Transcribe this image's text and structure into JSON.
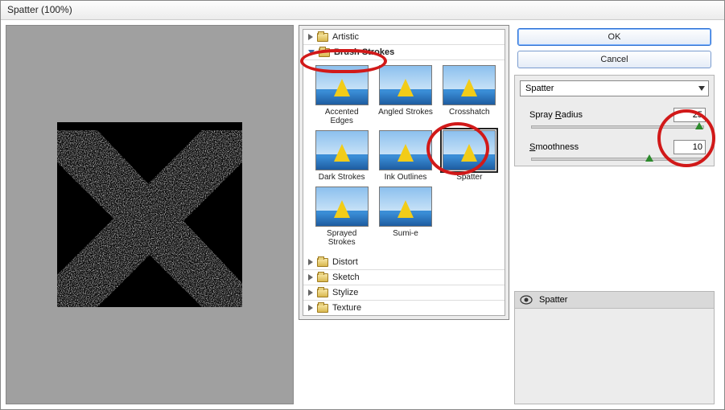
{
  "title": "Spatter (100%)",
  "buttons": {
    "ok": "OK",
    "cancel": "Cancel"
  },
  "categories": [
    {
      "label": "Artistic",
      "open": false
    },
    {
      "label": "Brush Strokes",
      "open": true,
      "bold": true
    },
    {
      "label": "Distort",
      "open": false
    },
    {
      "label": "Sketch",
      "open": false
    },
    {
      "label": "Stylize",
      "open": false
    },
    {
      "label": "Texture",
      "open": false
    }
  ],
  "thumbs": [
    {
      "label": "Accented Edges"
    },
    {
      "label": "Angled Strokes"
    },
    {
      "label": "Crosshatch"
    },
    {
      "label": "Dark Strokes"
    },
    {
      "label": "Ink Outlines"
    },
    {
      "label": "Spatter",
      "selected": true
    },
    {
      "label": "Sprayed Strokes"
    },
    {
      "label": "Sumi-e"
    }
  ],
  "filter_select": "Spatter",
  "params": {
    "spray_radius": {
      "label_pre": "Spray ",
      "label_u": "R",
      "label_post": "adius",
      "value": "25",
      "pos": 100
    },
    "smoothness": {
      "label_pre": "",
      "label_u": "S",
      "label_post": "moothness",
      "value": "10",
      "pos": 66
    }
  },
  "layers": [
    {
      "label": "Spatter"
    }
  ]
}
